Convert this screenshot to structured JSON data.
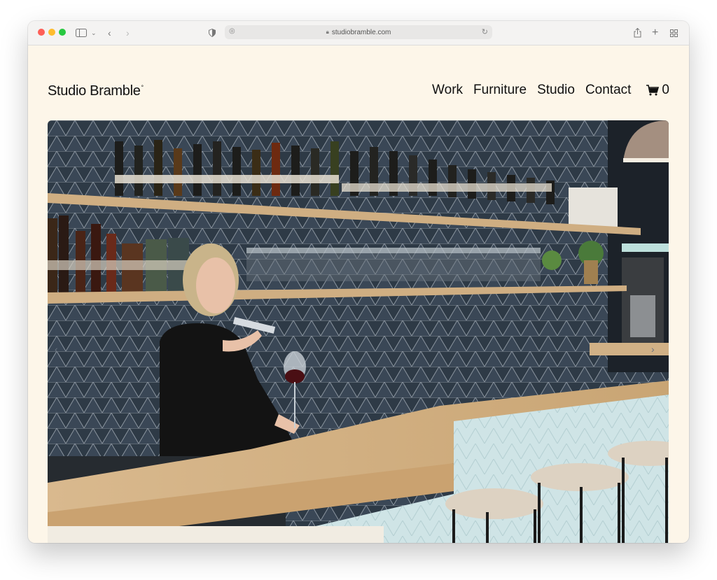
{
  "browser": {
    "url": "studiobramble.com"
  },
  "site": {
    "logo": "Studio Bramble",
    "logo_mark": "°",
    "nav": [
      "Work",
      "Furniture",
      "Studio",
      "Contact"
    ],
    "cart_count": "0"
  },
  "hero": {
    "image_alt": "Bartender pouring wine behind a wooden bar with dark tiled wall and shelves of bottles"
  },
  "colors": {
    "page_bg": "#fdf6e9",
    "text": "#111111",
    "tile_wall": "#2c3844",
    "counter_wood": "#d2b48c",
    "counter_front": "#cde3e5"
  }
}
